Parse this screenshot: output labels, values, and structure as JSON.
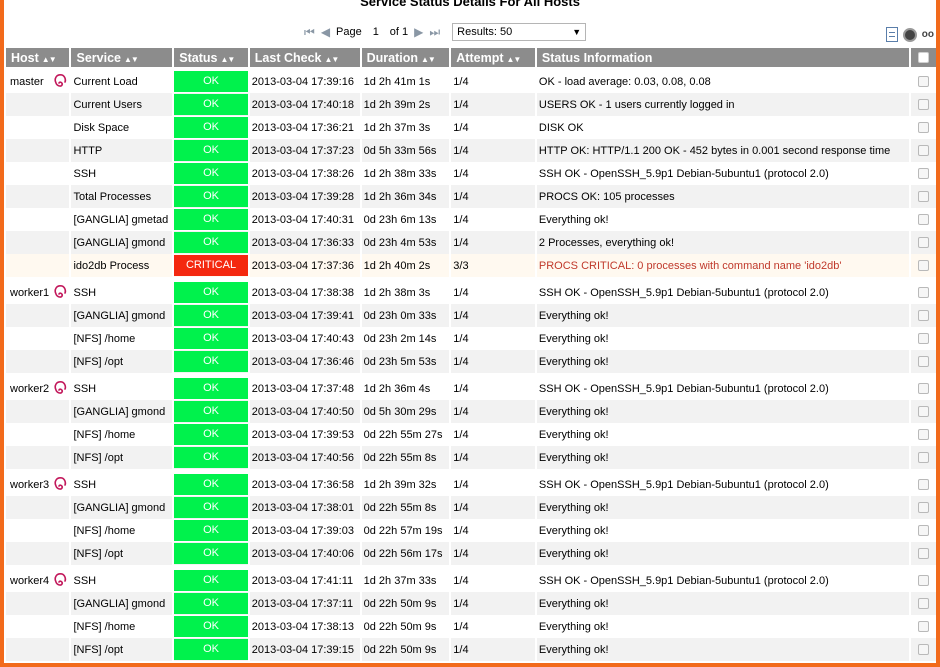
{
  "title": "Service Status Details For All Hosts",
  "pager": {
    "page_label": "Page",
    "page_value": "1",
    "of_label": "of 1",
    "results_label": "Results: 50"
  },
  "columns": {
    "host": "Host",
    "service": "Service",
    "status": "Status",
    "last_check": "Last Check",
    "duration": "Duration",
    "attempt": "Attempt",
    "status_info": "Status Information"
  },
  "colors": {
    "ok": "#00f24c",
    "critical": "#f4280f",
    "header": "#8c8c8c",
    "frame": "#f26a1b"
  },
  "icons": {
    "host_os": "debian-swirl-icon",
    "first_page": "first-page-icon",
    "prev_page": "prev-page-icon",
    "next_page": "next-page-icon",
    "last_page": "last-page-icon",
    "export": "document-icon",
    "refresh": "refresh-icon"
  },
  "rows": [
    {
      "host": "master",
      "service": "Current Load",
      "status": "OK",
      "last_check": "2013-03-04 17:39:16",
      "duration": "1d 2h 41m 1s",
      "attempt": "1/4",
      "info": "OK - load average: 0.03, 0.08, 0.08"
    },
    {
      "host": "",
      "service": "Current Users",
      "status": "OK",
      "last_check": "2013-03-04 17:40:18",
      "duration": "1d 2h 39m 2s",
      "attempt": "1/4",
      "info": "USERS OK - 1 users currently logged in"
    },
    {
      "host": "",
      "service": "Disk Space",
      "status": "OK",
      "last_check": "2013-03-04 17:36:21",
      "duration": "1d 2h 37m 3s",
      "attempt": "1/4",
      "info": "DISK OK"
    },
    {
      "host": "",
      "service": "HTTP",
      "status": "OK",
      "last_check": "2013-03-04 17:37:23",
      "duration": "0d 5h 33m 56s",
      "attempt": "1/4",
      "info": "HTTP OK: HTTP/1.1 200 OK - 452 bytes in 0.001 second response time"
    },
    {
      "host": "",
      "service": "SSH",
      "status": "OK",
      "last_check": "2013-03-04 17:38:26",
      "duration": "1d 2h 38m 33s",
      "attempt": "1/4",
      "info": "SSH OK - OpenSSH_5.9p1 Debian-5ubuntu1 (protocol 2.0)"
    },
    {
      "host": "",
      "service": "Total Processes",
      "status": "OK",
      "last_check": "2013-03-04 17:39:28",
      "duration": "1d 2h 36m 34s",
      "attempt": "1/4",
      "info": "PROCS OK: 105 processes"
    },
    {
      "host": "",
      "service": "[GANGLIA] gmetad",
      "status": "OK",
      "last_check": "2013-03-04 17:40:31",
      "duration": "0d 23h 6m 13s",
      "attempt": "1/4",
      "info": "Everything ok!"
    },
    {
      "host": "",
      "service": "[GANGLIA] gmond",
      "status": "OK",
      "last_check": "2013-03-04 17:36:33",
      "duration": "0d 23h 4m 53s",
      "attempt": "1/4",
      "info": "2 Processes, everything ok!"
    },
    {
      "host": "",
      "service": "ido2db Process",
      "status": "CRITICAL",
      "last_check": "2013-03-04 17:37:36",
      "duration": "1d 2h 40m 2s",
      "attempt": "3/3",
      "info": "PROCS CRITICAL: 0 processes with command name 'ido2db'"
    },
    {
      "host": "worker1",
      "service": "SSH",
      "status": "OK",
      "last_check": "2013-03-04 17:38:38",
      "duration": "1d 2h 38m 3s",
      "attempt": "1/4",
      "info": "SSH OK - OpenSSH_5.9p1 Debian-5ubuntu1 (protocol 2.0)"
    },
    {
      "host": "",
      "service": "[GANGLIA] gmond",
      "status": "OK",
      "last_check": "2013-03-04 17:39:41",
      "duration": "0d 23h 0m 33s",
      "attempt": "1/4",
      "info": "Everything ok!"
    },
    {
      "host": "",
      "service": "[NFS] /home",
      "status": "OK",
      "last_check": "2013-03-04 17:40:43",
      "duration": "0d 23h 2m 14s",
      "attempt": "1/4",
      "info": "Everything ok!"
    },
    {
      "host": "",
      "service": "[NFS] /opt",
      "status": "OK",
      "last_check": "2013-03-04 17:36:46",
      "duration": "0d 23h 5m 53s",
      "attempt": "1/4",
      "info": "Everything ok!"
    },
    {
      "host": "worker2",
      "service": "SSH",
      "status": "OK",
      "last_check": "2013-03-04 17:37:48",
      "duration": "1d 2h 36m 4s",
      "attempt": "1/4",
      "info": "SSH OK - OpenSSH_5.9p1 Debian-5ubuntu1 (protocol 2.0)"
    },
    {
      "host": "",
      "service": "[GANGLIA] gmond",
      "status": "OK",
      "last_check": "2013-03-04 17:40:50",
      "duration": "0d 5h 30m 29s",
      "attempt": "1/4",
      "info": "Everything ok!"
    },
    {
      "host": "",
      "service": "[NFS] /home",
      "status": "OK",
      "last_check": "2013-03-04 17:39:53",
      "duration": "0d 22h 55m 27s",
      "attempt": "1/4",
      "info": "Everything ok!"
    },
    {
      "host": "",
      "service": "[NFS] /opt",
      "status": "OK",
      "last_check": "2013-03-04 17:40:56",
      "duration": "0d 22h 55m 8s",
      "attempt": "1/4",
      "info": "Everything ok!"
    },
    {
      "host": "worker3",
      "service": "SSH",
      "status": "OK",
      "last_check": "2013-03-04 17:36:58",
      "duration": "1d 2h 39m 32s",
      "attempt": "1/4",
      "info": "SSH OK - OpenSSH_5.9p1 Debian-5ubuntu1 (protocol 2.0)"
    },
    {
      "host": "",
      "service": "[GANGLIA] gmond",
      "status": "OK",
      "last_check": "2013-03-04 17:38:01",
      "duration": "0d 22h 55m 8s",
      "attempt": "1/4",
      "info": "Everything ok!"
    },
    {
      "host": "",
      "service": "[NFS] /home",
      "status": "OK",
      "last_check": "2013-03-04 17:39:03",
      "duration": "0d 22h 57m 19s",
      "attempt": "1/4",
      "info": "Everything ok!"
    },
    {
      "host": "",
      "service": "[NFS] /opt",
      "status": "OK",
      "last_check": "2013-03-04 17:40:06",
      "duration": "0d 22h 56m 17s",
      "attempt": "1/4",
      "info": "Everything ok!"
    },
    {
      "host": "worker4",
      "service": "SSH",
      "status": "OK",
      "last_check": "2013-03-04 17:41:11",
      "duration": "1d 2h 37m 33s",
      "attempt": "1/4",
      "info": "SSH OK - OpenSSH_5.9p1 Debian-5ubuntu1 (protocol 2.0)"
    },
    {
      "host": "",
      "service": "[GANGLIA] gmond",
      "status": "OK",
      "last_check": "2013-03-04 17:37:11",
      "duration": "0d 22h 50m 9s",
      "attempt": "1/4",
      "info": "Everything ok!"
    },
    {
      "host": "",
      "service": "[NFS] /home",
      "status": "OK",
      "last_check": "2013-03-04 17:38:13",
      "duration": "0d 22h 50m 9s",
      "attempt": "1/4",
      "info": "Everything ok!"
    },
    {
      "host": "",
      "service": "[NFS] /opt",
      "status": "OK",
      "last_check": "2013-03-04 17:39:15",
      "duration": "0d 22h 50m 9s",
      "attempt": "1/4",
      "info": "Everything ok!"
    }
  ]
}
